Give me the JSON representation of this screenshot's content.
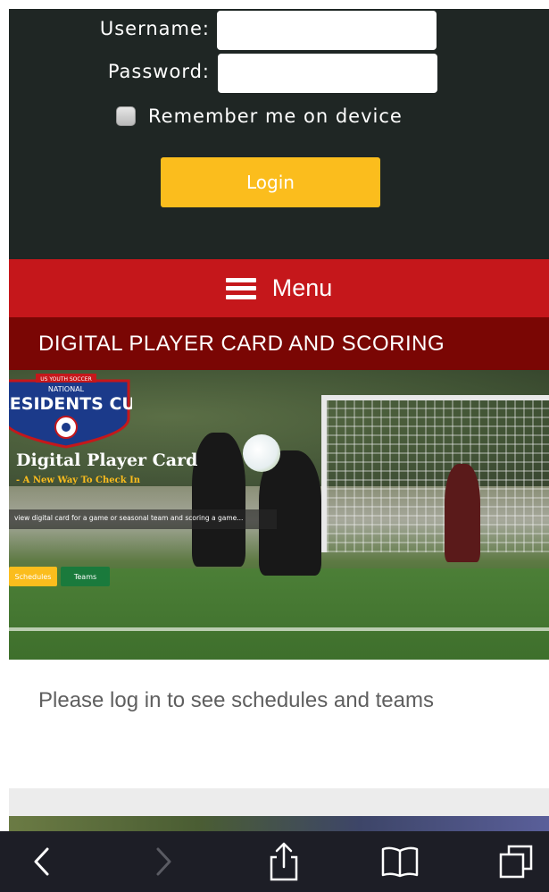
{
  "login": {
    "username_label": "Username:",
    "username_value": "",
    "password_label": "Password:",
    "password_value": "",
    "remember_label": "Remember me on device",
    "login_button": "Login"
  },
  "menu": {
    "label": "Menu",
    "icon": "hamburger-icon"
  },
  "section": {
    "title": "DIGITAL PLAYER CARD AND SCORING"
  },
  "hero": {
    "logo_line1": "US YOUTH SOCCER",
    "logo_line2": "NATIONAL",
    "logo_line3": "PRESIDENTS CUP",
    "card_title": "Digital Player Card",
    "card_subtitle": "- A New Way To Check In",
    "info_text": "view digital card for a game or seasonal team and scoring a game...",
    "schedules_label": "Schedules",
    "teams_label": "Teams"
  },
  "message": "Please log in to see schedules and teams",
  "browser_toolbar": {
    "icons": [
      "back-icon",
      "forward-icon",
      "share-icon",
      "bookmarks-icon",
      "tabs-icon"
    ]
  },
  "colors": {
    "login_bg": "#1f2624",
    "accent_yellow": "#fbbd1d",
    "menu_red": "#c5171b",
    "section_red": "#7a0604",
    "teams_green": "#1a7a3c"
  }
}
